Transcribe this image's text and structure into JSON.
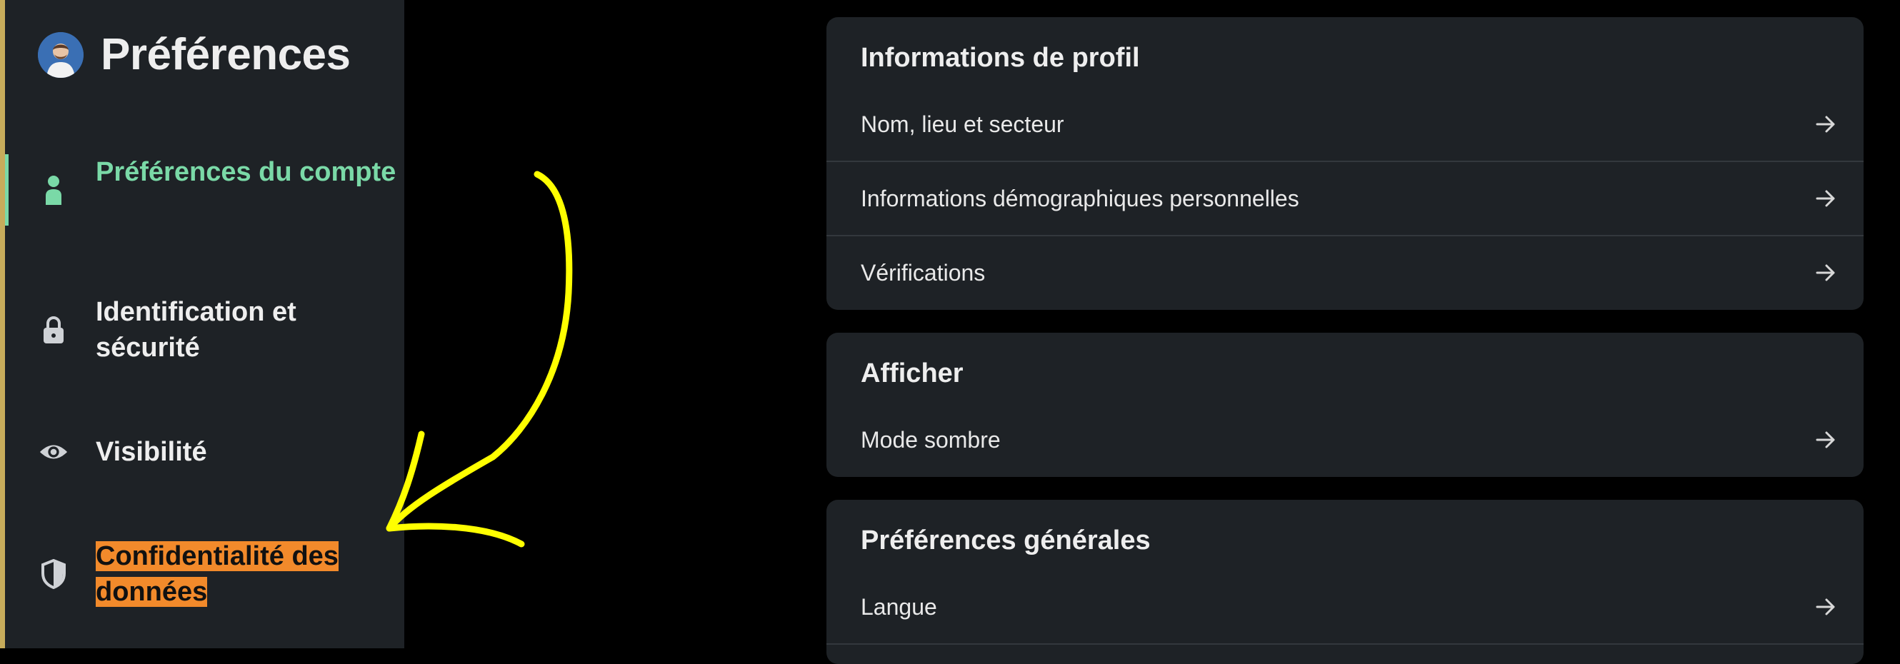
{
  "sidebar": {
    "title": "Préférences",
    "items": [
      {
        "icon": "person-icon",
        "label": "Préférences du compte",
        "active": true
      },
      {
        "icon": "lock-icon",
        "label": "Identification et sécurité"
      },
      {
        "icon": "eye-icon",
        "label": "Visibilité"
      },
      {
        "icon": "shield-icon",
        "label": "Confidentialité des données",
        "highlighted": true
      }
    ]
  },
  "sections": [
    {
      "title": "Informations de profil",
      "rows": [
        "Nom, lieu et secteur",
        "Informations démographiques personnelles",
        "Vérifications"
      ]
    },
    {
      "title": "Afficher",
      "rows": [
        "Mode sombre"
      ]
    },
    {
      "title": "Préférences générales",
      "rows": [
        "Langue"
      ]
    }
  ],
  "colors": {
    "accent": "#7ad9a7",
    "highlight": "#f28a2b",
    "annotation": "#ffff00",
    "card": "#1e2226"
  }
}
